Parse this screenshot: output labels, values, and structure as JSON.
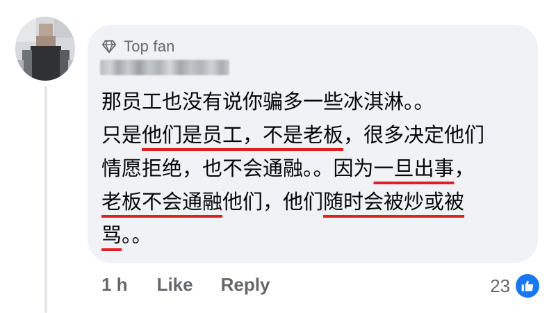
{
  "comment": {
    "badge": {
      "label": "Top fan",
      "icon": "diamond-icon"
    },
    "author": {
      "name": "████████ ██",
      "avatar_icon": "blurred-avatar"
    },
    "lines": [
      [
        {
          "text": "那员工也没有说你骗多一些冰淇淋。。",
          "underline": false
        }
      ],
      [
        {
          "text": "只是",
          "underline": false
        },
        {
          "text": "他们是员工，不是老板",
          "underline": true
        },
        {
          "text": "，很多决定他们",
          "underline": false
        }
      ],
      [
        {
          "text": "情愿拒绝，也不会通融。。因为",
          "underline": false
        },
        {
          "text": "一旦出事",
          "underline": true
        },
        {
          "text": "，",
          "underline": false
        }
      ],
      [
        {
          "text": "老板不会通融",
          "underline": true
        },
        {
          "text": "他们，他们",
          "underline": false
        },
        {
          "text": "随时会被炒或被",
          "underline": true
        }
      ],
      [
        {
          "text": "骂",
          "underline": true
        },
        {
          "text": "。。",
          "underline": false
        }
      ]
    ],
    "underline_color": "#e41e26",
    "bubble_color": "#f0f2f5"
  },
  "actions": {
    "time": "1 h",
    "like_label": "Like",
    "reply_label": "Reply"
  },
  "reactions": {
    "count": "23",
    "icon": "thumbs-up-icon",
    "color": "#1877f2"
  }
}
